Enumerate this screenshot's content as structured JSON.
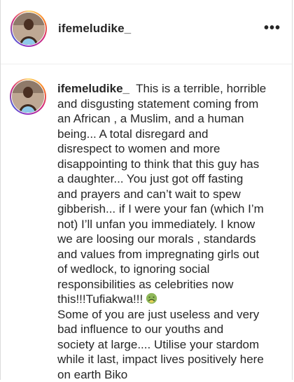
{
  "header": {
    "username": "ifemeludike_",
    "more_label": "•••"
  },
  "comment": {
    "username": "ifemeludike_",
    "lines": [
      "This is a terrible, horrible",
      "and disgusting statement coming from",
      "an African , a Muslim, and a human",
      "being... A total disregard and",
      "disrespect to women and more",
      "disappointing to think that this guy has",
      "a daughter... You just got off fasting",
      "and prayers and can’t wait to spew",
      "gibberish... if I were your fan (which I’m",
      "not) I’ll unfan you immediately. I know",
      "we are loosing our morals , standards",
      "and values from impregnating girls out",
      "of wedlock, to ignoring social",
      "responsibilities as celebrities now",
      "this!!!Tufiakwa!!!",
      "Some of you are just useless and very",
      "bad influence to our youths and",
      "society at large.... Utilise your stardom",
      "while it last, impact lives positively here",
      "on earth Biko"
    ],
    "emoji_icon": "nauseated-face-icon"
  }
}
